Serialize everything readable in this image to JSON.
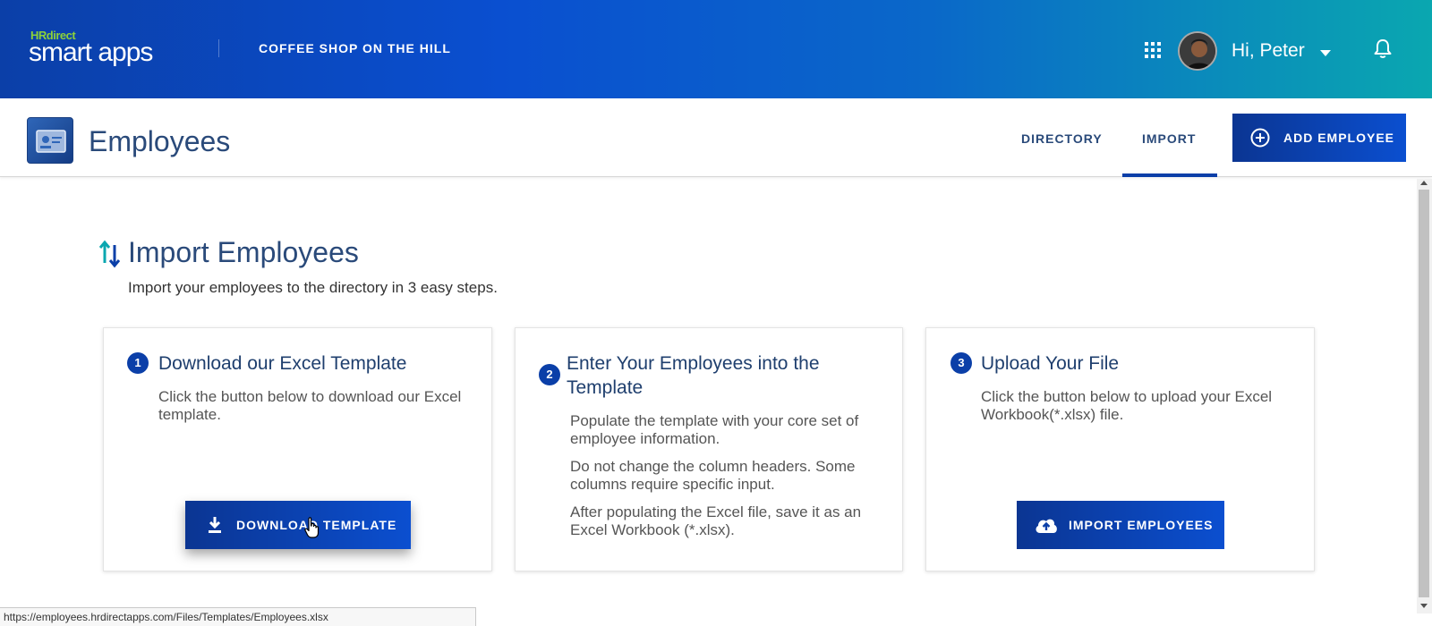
{
  "header": {
    "logo_hr": "HRdirect",
    "logo_main": "smart apps",
    "company": "COFFEE SHOP ON THE HILL",
    "greeting": "Hi, Peter",
    "icons": [
      "apps-grid-icon",
      "avatar",
      "chevron-down-icon",
      "bell-icon"
    ]
  },
  "subheader": {
    "title": "Employees",
    "tabs": [
      {
        "label": "DIRECTORY",
        "active": false
      },
      {
        "label": "IMPORT",
        "active": true
      }
    ],
    "add_button": "ADD EMPLOYEE"
  },
  "main": {
    "title": "Import Employees",
    "subtitle": "Import your employees to the directory in 3 easy steps.",
    "steps": [
      {
        "number": "1",
        "title": "Download our Excel Template",
        "paragraphs": [
          "Click the button below to download our Excel template."
        ],
        "button": "DOWNLOAD TEMPLATE"
      },
      {
        "number": "2",
        "title": "Enter Your Employees into the Template",
        "paragraphs": [
          "Populate the template with your core set of employee information.",
          "Do not change the column headers. Some columns require specific input.",
          "After populating the Excel file, save it as an Excel Workbook (*.xlsx)."
        ]
      },
      {
        "number": "3",
        "title": "Upload Your File",
        "paragraphs": [
          "Click the button below to upload your Excel Workbook(*.xlsx) file."
        ],
        "button": "IMPORT EMPLOYEES"
      }
    ]
  },
  "status_url": "https://employees.hrdirectapps.com/Files/Templates/Employees.xlsx",
  "colors": {
    "primary": "#0b3fa8",
    "title_text": "#2a4a7a",
    "header_gradient_end": "#0aa7b0"
  }
}
